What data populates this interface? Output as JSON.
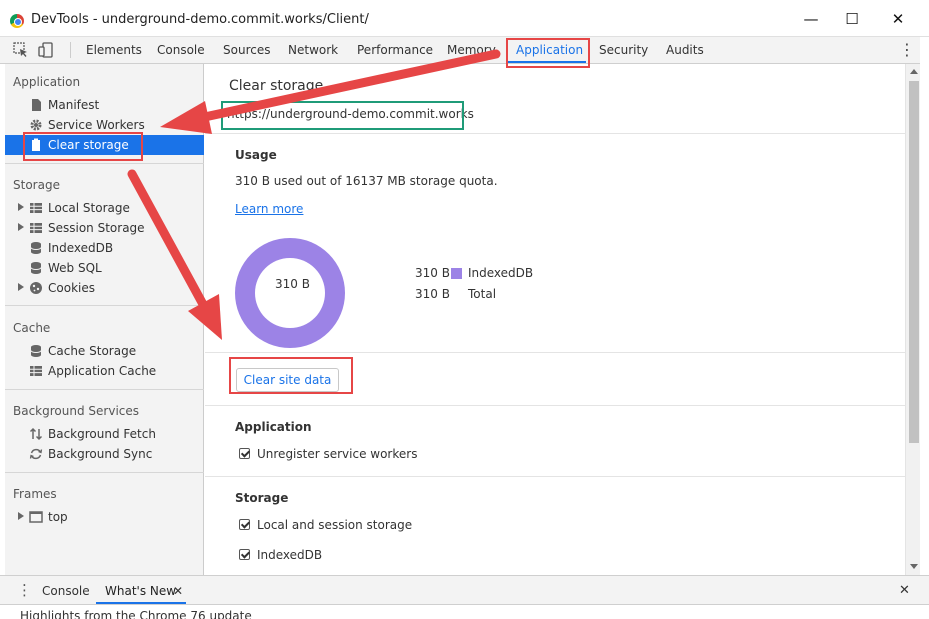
{
  "window": {
    "title": "DevTools - underground-demo.commit.works/Client/",
    "minimize": "—",
    "maximize": "☐",
    "close": "✕"
  },
  "tabs": [
    "Elements",
    "Console",
    "Sources",
    "Network",
    "Performance",
    "Memory",
    "Application",
    "Security",
    "Audits"
  ],
  "active_tab": "Application",
  "sidebar": {
    "application_header": "Application",
    "application_items": [
      "Manifest",
      "Service Workers",
      "Clear storage"
    ],
    "storage_header": "Storage",
    "storage_items": [
      "Local Storage",
      "Session Storage",
      "IndexedDB",
      "Web SQL",
      "Cookies"
    ],
    "cache_header": "Cache",
    "cache_items": [
      "Cache Storage",
      "Application Cache"
    ],
    "background_header": "Background Services",
    "background_items": [
      "Background Fetch",
      "Background Sync"
    ],
    "frames_header": "Frames",
    "frames_items": [
      "top"
    ]
  },
  "main": {
    "title": "Clear storage",
    "origin": "https://underground-demo.commit.works",
    "usage_title": "Usage",
    "usage_text": "310 B used out of 16137 MB storage quota.",
    "learn_more": "Learn more",
    "donut_label": "310 B",
    "legend": [
      {
        "value": "310 B",
        "label": "IndexedDB",
        "color": "#9c83e6"
      },
      {
        "value": "310 B",
        "label": "Total"
      }
    ],
    "clear_button": "Clear site data",
    "application_title": "Application",
    "application_checks": [
      "Unregister service workers"
    ],
    "storage_title": "Storage",
    "storage_checks": [
      "Local and session storage",
      "IndexedDB"
    ]
  },
  "drawer": {
    "tabs": [
      "Console",
      "What's New"
    ],
    "close_tab": "✕",
    "close": "✕",
    "text": "Highlights from the Chrome 76 update"
  },
  "colors": {
    "accent": "#1a73e8",
    "annotation_red": "#e64646",
    "annotation_green": "#1f9b78",
    "donut": "#9c83e6"
  }
}
